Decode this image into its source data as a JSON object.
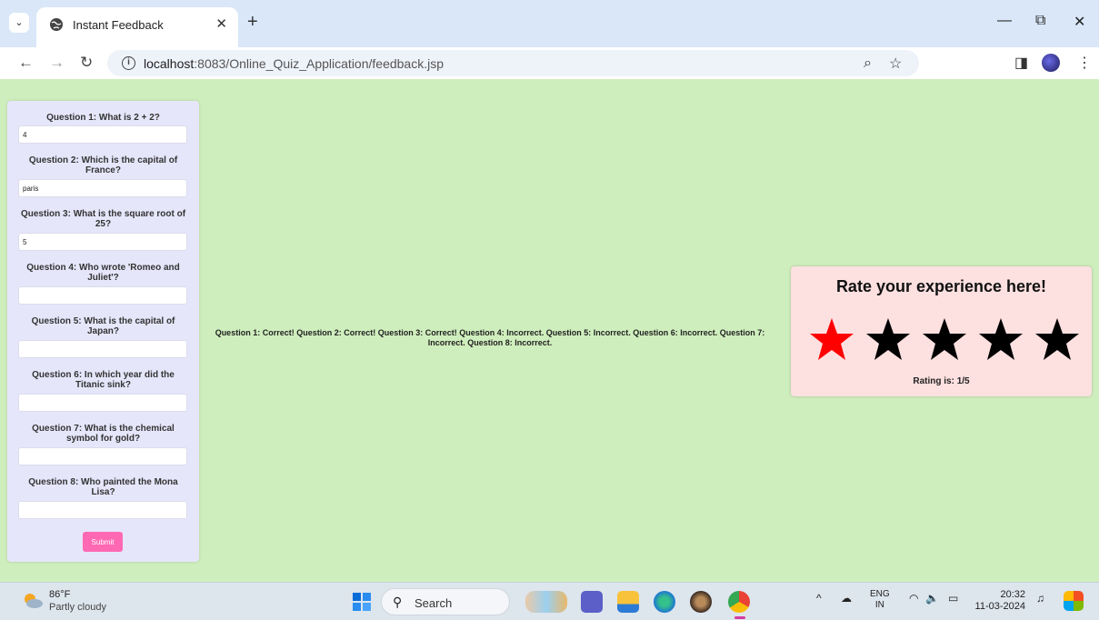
{
  "browser": {
    "tab_title": "Instant Feedback",
    "url_host": "localhost",
    "url_rest": ":8083/Online_Quiz_Application/feedback.jsp"
  },
  "quiz": {
    "questions": [
      {
        "label": "Question 1: What is 2 + 2?",
        "value": "4"
      },
      {
        "label": "Question 2: Which is the capital of France?",
        "value": "paris"
      },
      {
        "label": "Question 3: What is the square root of 25?",
        "value": "5"
      },
      {
        "label": "Question 4: Who wrote 'Romeo and Juliet'?",
        "value": ""
      },
      {
        "label": "Question 5: What is the capital of Japan?",
        "value": ""
      },
      {
        "label": "Question 6: In which year did the Titanic sink?",
        "value": ""
      },
      {
        "label": "Question 7: What is the chemical symbol for gold?",
        "value": ""
      },
      {
        "label": "Question 8: Who painted the Mona Lisa?",
        "value": ""
      }
    ],
    "submit_label": "Submit"
  },
  "results": {
    "text": "Question 1: Correct! Question 2: Correct! Question 3: Correct! Question 4: Incorrect. Question 5: Incorrect. Question 6: Incorrect. Question 7: Incorrect. Question 8: Incorrect."
  },
  "rating": {
    "title": "Rate your experience here!",
    "value": 1,
    "max": 5,
    "text": "Rating is: 1/5",
    "active_color": "#ff0000",
    "inactive_color": "#000000"
  },
  "taskbar": {
    "temperature": "86°F",
    "weather": "Partly cloudy",
    "search_label": "Search",
    "lang_top": "ENG",
    "lang_bottom": "IN",
    "time": "20:32",
    "date": "11-03-2024"
  },
  "colors": {
    "page_bg": "#cfeebd",
    "quiz_panel_bg": "#e6e6fb",
    "rating_card_bg": "#fde0e0",
    "submit_bg": "#ff69b4"
  }
}
